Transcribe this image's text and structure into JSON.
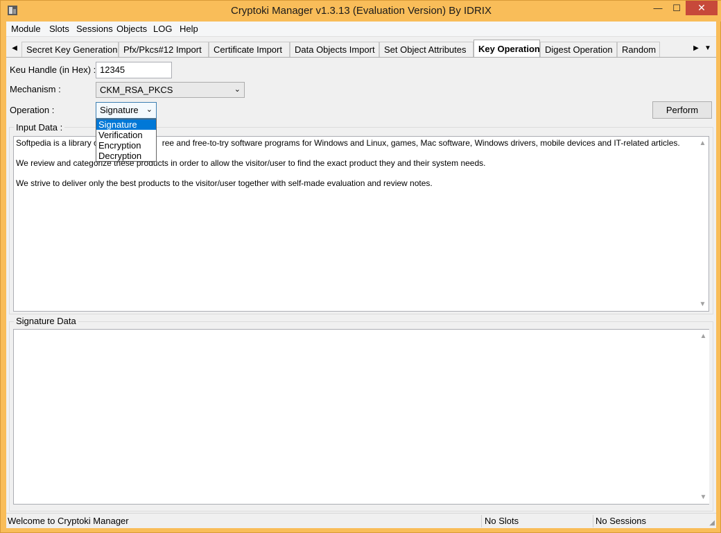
{
  "window": {
    "title": "Cryptoki Manager v1.3.13  (Evaluation Version)  By IDRIX",
    "minimize_glyph": "—",
    "maximize_glyph": "☐",
    "close_glyph": "✕"
  },
  "menu": {
    "items": [
      "Module",
      "Slots",
      "Sessions",
      "Objects",
      "LOG",
      "Help"
    ]
  },
  "tabs": {
    "items": [
      "Secret Key Generation",
      "Pfx/Pkcs#12 Import",
      "Certificate Import",
      "Data Objects Import",
      "Set Object Attributes",
      "Key Operation",
      "Digest Operation",
      "Random"
    ],
    "active": "Key Operation",
    "scroll_left": "◀",
    "scroll_right": "▶",
    "overflow": "▼"
  },
  "form": {
    "key_handle_label": "Keu Handle (in Hex)  :",
    "key_handle_value": "12345",
    "mechanism_label": "Mechanism :",
    "mechanism_value": "CKM_RSA_PKCS",
    "operation_label": "Operation :",
    "operation_value": "Signature",
    "operation_options": [
      "Signature",
      "Verification",
      "Encryption",
      "Decryption"
    ],
    "perform_label": "Perform",
    "combo_arrow": "⌄"
  },
  "input_data": {
    "title": "Input Data :",
    "lines": [
      "Softpedia is a library o",
      "We review and categorize these products in order to allow the visitor/user to find the exact product they and their system needs.",
      "We strive to deliver only the best products to the visitor/user together with self-made evaluation and review notes."
    ],
    "line1_tail": "ree and free-to-try software programs for Windows and Linux, games, Mac software, Windows drivers, mobile devices and IT-related articles."
  },
  "signature_data": {
    "title": "Signature Data",
    "content": ""
  },
  "status": {
    "message": "Welcome to Cryptoki Manager",
    "slots": "No Slots",
    "sessions": "No Sessions"
  }
}
